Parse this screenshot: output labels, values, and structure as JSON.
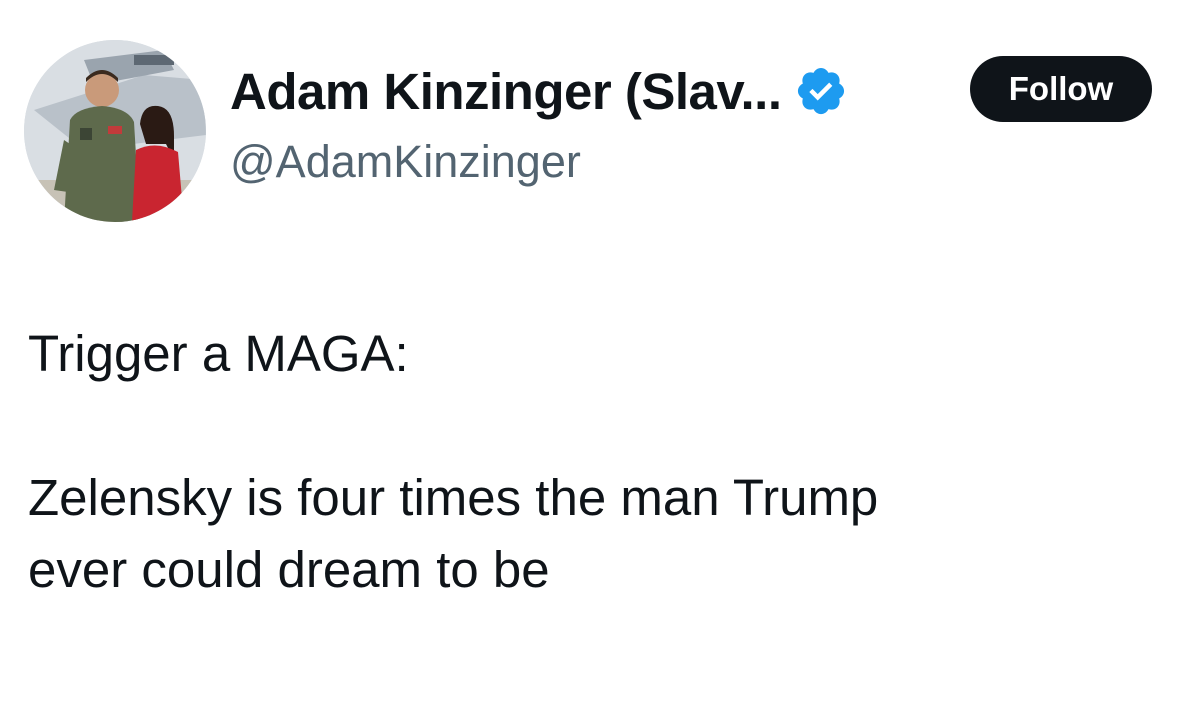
{
  "author": {
    "display_name": "Adam Kinzinger (Slav...",
    "handle": "@AdamKinzinger",
    "verified": true,
    "verified_icon": "verified-badge-icon",
    "badge_color": "#1d9bf0"
  },
  "actions": {
    "follow_label": "Follow"
  },
  "tweet": {
    "line1": "Trigger a MAGA:",
    "line2": "Zelensky is four times the man Trump",
    "line3": "ever could dream to be"
  },
  "colors": {
    "text": "#0f1419",
    "handle": "#536471",
    "button_bg": "#0f1419",
    "button_text": "#ffffff"
  }
}
